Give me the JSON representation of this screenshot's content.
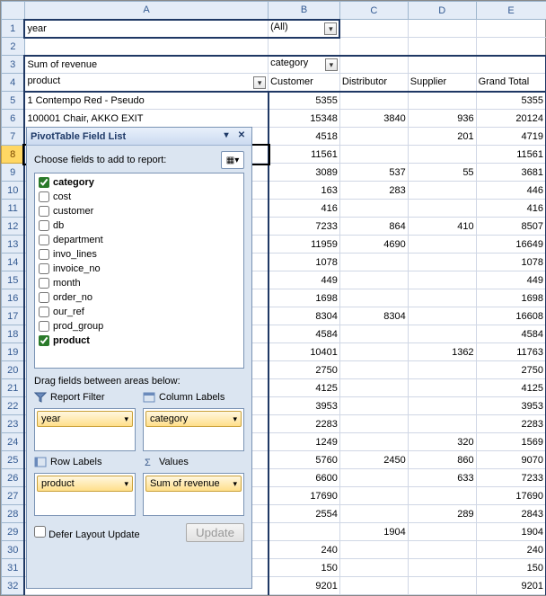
{
  "columns": [
    "A",
    "B",
    "C",
    "D",
    "E"
  ],
  "rows": [
    1,
    2,
    3,
    4,
    5,
    6,
    7,
    8,
    9,
    10,
    11,
    12,
    13,
    14,
    15,
    16,
    17,
    18,
    19,
    20,
    21,
    22,
    23,
    24,
    25,
    26,
    27,
    28,
    29,
    30,
    31,
    32
  ],
  "filter": {
    "label": "year",
    "value": "(All)"
  },
  "pivot": {
    "measure": "Sum of revenue",
    "colfield": "category",
    "rowfield": "product",
    "cols": [
      "Customer",
      "Distributor",
      "Supplier",
      "Grand Total"
    ]
  },
  "data": [
    {
      "p": "1 Contempo Red - Pseudo",
      "c": 5355,
      "d": null,
      "s": null,
      "t": 5355
    },
    {
      "p": "100001 Chair, AKKO EXIT",
      "c": 15348,
      "d": 3840,
      "s": 936,
      "t": 20124
    },
    {
      "p": "",
      "c": 4518,
      "d": null,
      "s": 201,
      "t": 4719
    },
    {
      "p": "",
      "c": 11561,
      "d": null,
      "s": null,
      "t": 11561
    },
    {
      "p": "",
      "c": 3089,
      "d": 537,
      "s": 55,
      "t": 3681
    },
    {
      "p": "",
      "c": 163,
      "d": 283,
      "s": null,
      "t": 446
    },
    {
      "p": "",
      "c": 416,
      "d": null,
      "s": null,
      "t": 416
    },
    {
      "p": "",
      "c": 7233,
      "d": 864,
      "s": 410,
      "t": 8507
    },
    {
      "p": "",
      "c": 11959,
      "d": 4690,
      "s": null,
      "t": 16649
    },
    {
      "p": "",
      "c": 1078,
      "d": null,
      "s": null,
      "t": 1078
    },
    {
      "p": "",
      "c": 449,
      "d": null,
      "s": null,
      "t": 449
    },
    {
      "p": "",
      "c": 1698,
      "d": null,
      "s": null,
      "t": 1698
    },
    {
      "p": "",
      "c": 8304,
      "d": 8304,
      "s": null,
      "t": 16608
    },
    {
      "p": "",
      "c": 4584,
      "d": null,
      "s": null,
      "t": 4584
    },
    {
      "p": "",
      "c": 10401,
      "d": null,
      "s": 1362,
      "t": 11763
    },
    {
      "p": "",
      "c": 2750,
      "d": null,
      "s": null,
      "t": 2750
    },
    {
      "p": "",
      "c": 4125,
      "d": null,
      "s": null,
      "t": 4125
    },
    {
      "p": "",
      "c": 3953,
      "d": null,
      "s": null,
      "t": 3953
    },
    {
      "p": "",
      "c": 2283,
      "d": null,
      "s": null,
      "t": 2283
    },
    {
      "p": "",
      "c": 1249,
      "d": null,
      "s": 320,
      "t": 1569
    },
    {
      "p": "",
      "c": 5760,
      "d": 2450,
      "s": 860,
      "t": 9070
    },
    {
      "p": "",
      "c": 6600,
      "d": null,
      "s": 633,
      "t": 7233
    },
    {
      "p": "",
      "c": 17690,
      "d": null,
      "s": null,
      "t": 17690
    },
    {
      "p": "",
      "c": 2554,
      "d": null,
      "s": 289,
      "t": 2843
    },
    {
      "p": "",
      "c": null,
      "d": 1904,
      "s": null,
      "t": 1904
    },
    {
      "p": "",
      "c": 240,
      "d": null,
      "s": null,
      "t": 240
    },
    {
      "p": "",
      "c": 150,
      "d": null,
      "s": null,
      "t": 150
    },
    {
      "p": "",
      "c": 9201,
      "d": null,
      "s": null,
      "t": 9201
    }
  ],
  "pane": {
    "title": "PivotTable Field List",
    "choose": "Choose fields to add to report:",
    "fields": [
      {
        "name": "category",
        "checked": true
      },
      {
        "name": "cost",
        "checked": false
      },
      {
        "name": "customer",
        "checked": false
      },
      {
        "name": "db",
        "checked": false
      },
      {
        "name": "department",
        "checked": false
      },
      {
        "name": "invo_lines",
        "checked": false
      },
      {
        "name": "invoice_no",
        "checked": false
      },
      {
        "name": "month",
        "checked": false
      },
      {
        "name": "order_no",
        "checked": false
      },
      {
        "name": "our_ref",
        "checked": false
      },
      {
        "name": "prod_group",
        "checked": false
      },
      {
        "name": "product",
        "checked": true
      }
    ],
    "draglabel": "Drag fields between areas below:",
    "areas": {
      "filter": {
        "label": "Report Filter",
        "item": "year"
      },
      "collab": {
        "label": "Column Labels",
        "item": "category"
      },
      "rowlab": {
        "label": "Row Labels",
        "item": "product"
      },
      "values": {
        "label": "Values",
        "item": "Sum of revenue"
      }
    },
    "defer": "Defer Layout Update",
    "update": "Update"
  }
}
